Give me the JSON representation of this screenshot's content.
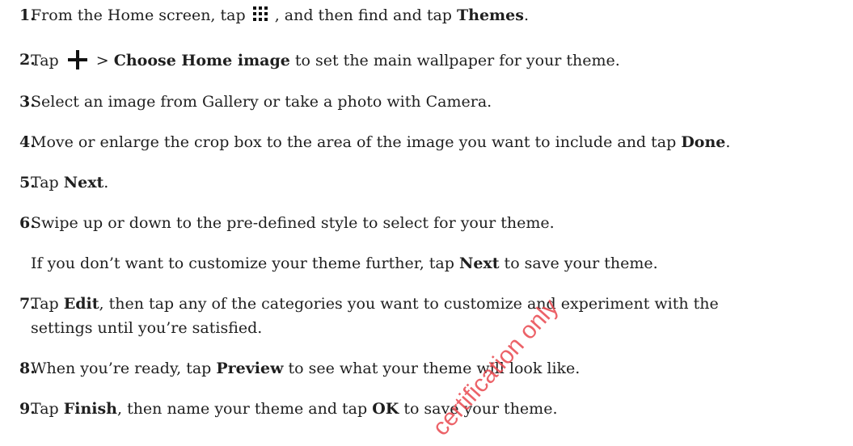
{
  "steps": [
    {
      "num": "1.",
      "before": "From the Home screen, tap ",
      "icon": "apps-grid-icon",
      "mid": " , and then find and tap ",
      "bold": "Themes",
      "after": "."
    },
    {
      "num": "2.",
      "before": "Tap ",
      "icon": "plus-icon",
      "mid": " > ",
      "bold": "Choose Home image",
      "after": " to set the main wallpaper for your theme."
    },
    {
      "num": "3.",
      "text": "Select an image from Gallery or take a photo with Camera."
    },
    {
      "num": "4.",
      "before": "Move or enlarge the crop box to the area of the image you want to include and tap ",
      "bold": "Done",
      "after": "."
    },
    {
      "num": "5.",
      "before": "Tap ",
      "bold": "Next",
      "after": "."
    },
    {
      "num": "6.",
      "text": "Swipe up or down to the pre-defined style to select for your theme.",
      "sub_before": "If you don’t want to customize your theme further, tap ",
      "sub_bold": "Next",
      "sub_after": " to save your theme."
    },
    {
      "num": "7.",
      "before": "Tap ",
      "bold": "Edit",
      "after": ", then tap any of the categories you want to customize and experiment with the",
      "cont": "settings until you’re satisfied."
    },
    {
      "num": "8.",
      "before": "When you’re ready, tap ",
      "bold": "Preview",
      "after": " to see what your theme will look like."
    },
    {
      "num": "9.",
      "before": "Tap ",
      "bold": "Finish",
      "mid": ", then name your theme and tap ",
      "bold2": "OK",
      "after": " to save your theme."
    }
  ],
  "watermark": "certification only",
  "colors": {
    "text": "#1f1f1f",
    "watermark": "#e9474d"
  }
}
